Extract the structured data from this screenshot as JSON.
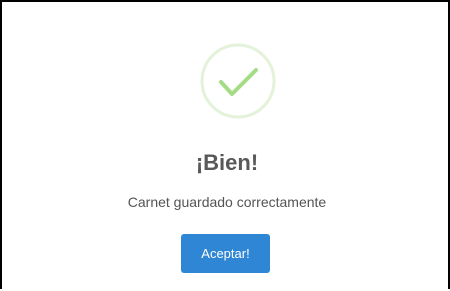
{
  "dialog": {
    "icon": "check-circle-icon",
    "title": "¡Bien!",
    "message": "Carnet guardado correctamente",
    "confirm_label": "Aceptar!"
  },
  "colors": {
    "accent": "#2f86d4",
    "success_ring": "#e3f2d8",
    "success_check": "#a5dc86",
    "title_text": "#595959",
    "message_text": "#545454"
  }
}
